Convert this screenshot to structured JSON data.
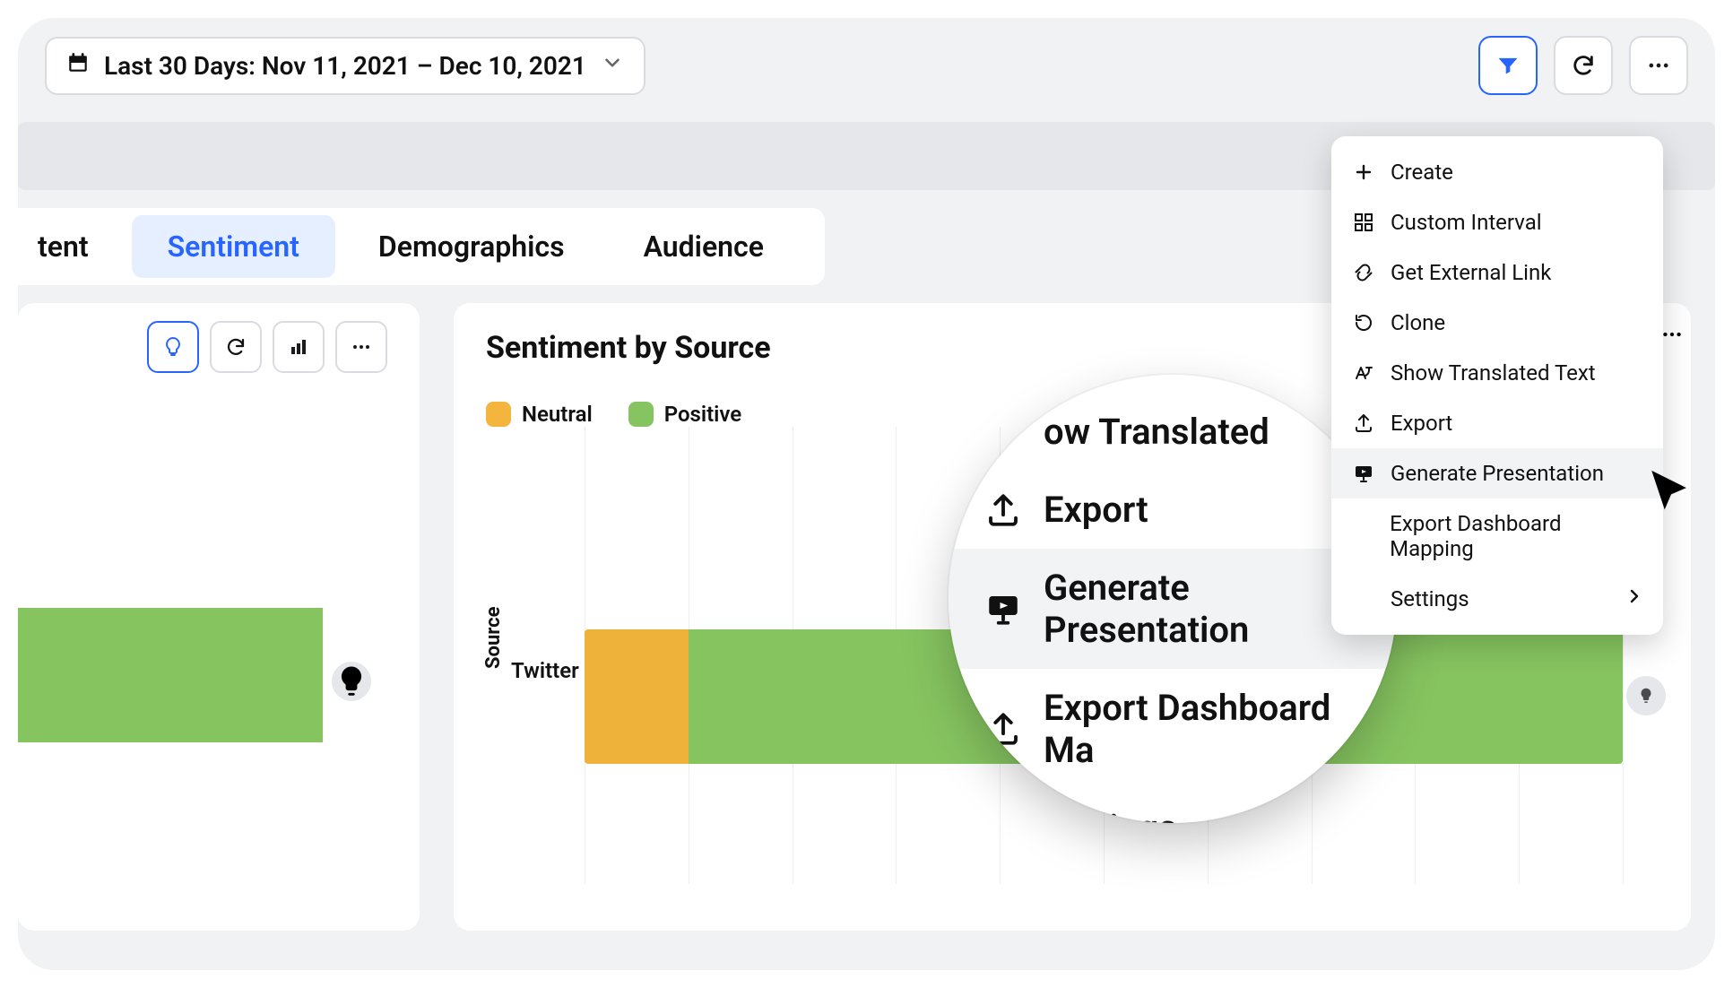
{
  "toolbar": {
    "date_label": "Last 30 Days: Nov 11, 2021 – Dec 10, 2021"
  },
  "tabs": {
    "partial0": "tent",
    "sentiment": "Sentiment",
    "demographics": "Demographics",
    "audience": "Audience"
  },
  "card_left": {
    "bar_positive_pct": 100
  },
  "card_right": {
    "title": "Sentiment by Source",
    "legend_neutral": "Neutral",
    "legend_positive": "Positive",
    "y_axis": "Source",
    "category": "Twitter"
  },
  "menu": {
    "create": "Create",
    "custom_interval": "Custom Interval",
    "get_link": "Get External Link",
    "clone": "Clone",
    "show_translated": "Show Translated Text",
    "export": "Export",
    "generate_presentation": "Generate Presentation",
    "export_mapping": "Export Dashboard Mapping",
    "settings": "Settings"
  },
  "magnifier": {
    "translated_partial": "ow Translated",
    "export": "Export",
    "generate_presentation": "Generate Presentation",
    "export_mapping": "Export Dashboard Ma",
    "settings": "Settings"
  },
  "chart_data": {
    "type": "bar",
    "orientation": "horizontal-stacked",
    "title": "Sentiment by Source",
    "ylabel": "Source",
    "categories": [
      "Twitter"
    ],
    "series": [
      {
        "name": "Neutral",
        "color": "#eeb23b",
        "values": [
          10
        ]
      },
      {
        "name": "Positive",
        "color": "#86c460",
        "values": [
          90
        ]
      }
    ],
    "xlim": [
      0,
      100
    ]
  }
}
